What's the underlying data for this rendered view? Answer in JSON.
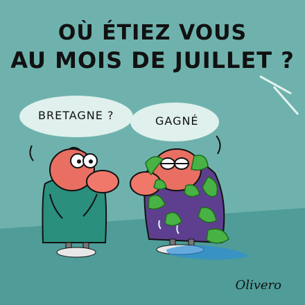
{
  "cartoon": {
    "title_line1": "OÙ ÉTIEZ VOUS",
    "title_line2": "AU MOIS DE JUILLET ?",
    "left_character": {
      "speech": "BRETAGNE ?"
    },
    "right_character": {
      "speech": "GAGNÉ"
    },
    "signature": "Olivero"
  },
  "colors": {
    "background": "#6fb2ad",
    "floor": "#4f9c98",
    "bubble": "#dff0ed",
    "skin": "#e96f63",
    "left_shirt": "#2b8f7e",
    "right_shirt": "#5e3f8f",
    "seaweed": "#49b244",
    "puddle": "#2f8fd7"
  }
}
